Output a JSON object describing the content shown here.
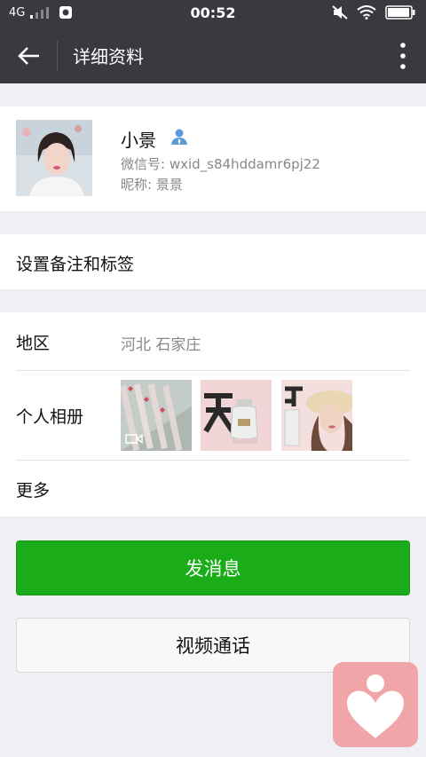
{
  "status_bar": {
    "network": "4G",
    "time": "00:52"
  },
  "header": {
    "title": "详细资料"
  },
  "profile": {
    "name": "小景",
    "wechat_id": "微信号: wxid_s84hddamr6pj22",
    "nickname": "昵称: 景景"
  },
  "remark": {
    "label": "设置备注和标签"
  },
  "info": {
    "region_label": "地区",
    "region_value": "河北  石家庄",
    "album_label": "个人相册",
    "more_label": "更多"
  },
  "buttons": {
    "message": "发消息",
    "video_call": "视频通话"
  },
  "colors": {
    "primary": "#1aad19",
    "header": "#393a3f",
    "floating": "#f0a5a8"
  }
}
